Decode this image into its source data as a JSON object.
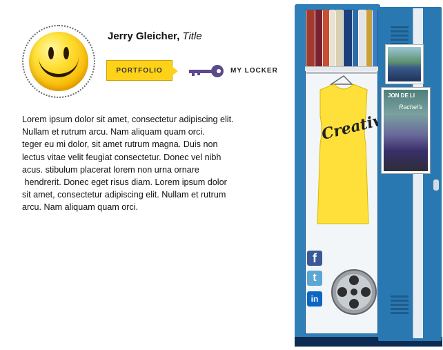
{
  "profile": {
    "name": "Jerry Gleicher,",
    "title": "Title"
  },
  "nav": {
    "portfolio_label": "PORTFOLIO",
    "locker_label": "MY LOCKER"
  },
  "bio": {
    "text": "Lorem ipsum dolor sit amet, consectetur adipiscing elit.\nNullam et rutrum arcu. Nam aliquam quam orci.\nteger eu mi dolor, sit amet rutrum magna. Duis non\nlectus vitae velit feugiat consectetur. Donec vel nibh\nacus. stibulum placerat lorem non urna ornare\n hendrerit. Donec eget risus diam. Lorem ipsum dolor\nsit amet, consectetur adipiscing elit. Nullam et rutrum\narcu. Nam aliquam quam orci."
  },
  "locker": {
    "shirt_text": "Creative",
    "photo_sign_line1": "JON DE LI",
    "photo_sign_line2": "Rachel's"
  },
  "social": {
    "facebook_glyph": "f",
    "twitter_glyph": "t",
    "linkedin_glyph": "in"
  },
  "colors": {
    "accent_yellow": "#ffd21a",
    "locker_blue": "#2f7fb9",
    "key_purple": "#5b4a8c"
  }
}
